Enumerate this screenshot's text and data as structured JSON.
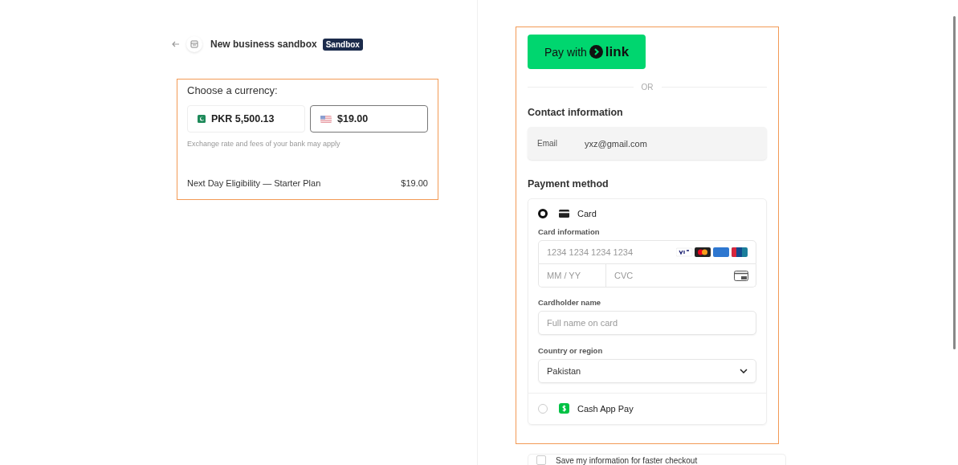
{
  "header": {
    "business_name": "New business sandbox",
    "badge": "Sandbox"
  },
  "currency": {
    "title": "Choose a currency:",
    "options": [
      {
        "kind": "pkr",
        "label": "PKR 5,500.13",
        "selected": false
      },
      {
        "kind": "usd",
        "label": "$19.00",
        "selected": true
      }
    ],
    "note": "Exchange rate and fees of your bank may apply"
  },
  "line_item": {
    "name": "Next Day Eligibility — Starter Plan",
    "price": "$19.00"
  },
  "link_button": {
    "prefix": "Pay with",
    "brand": "link"
  },
  "divider": "OR",
  "contact": {
    "heading": "Contact information",
    "email_label": "Email",
    "email": "yxz@gmail.com"
  },
  "payment": {
    "heading": "Payment method",
    "methods": [
      {
        "kind": "card",
        "label": "Card",
        "selected": true
      },
      {
        "kind": "cashapp",
        "label": "Cash App Pay",
        "selected": false
      }
    ],
    "card_info_label": "Card information",
    "card_number_placeholder": "1234 1234 1234 1234",
    "expiry_placeholder": "MM / YY",
    "cvc_placeholder": "CVC",
    "cardholder_label": "Cardholder name",
    "cardholder_placeholder": "Full name on card",
    "country_label": "Country or region",
    "country": "Pakistan"
  },
  "save_info": {
    "label": "Save my information for faster checkout",
    "checked": false
  }
}
